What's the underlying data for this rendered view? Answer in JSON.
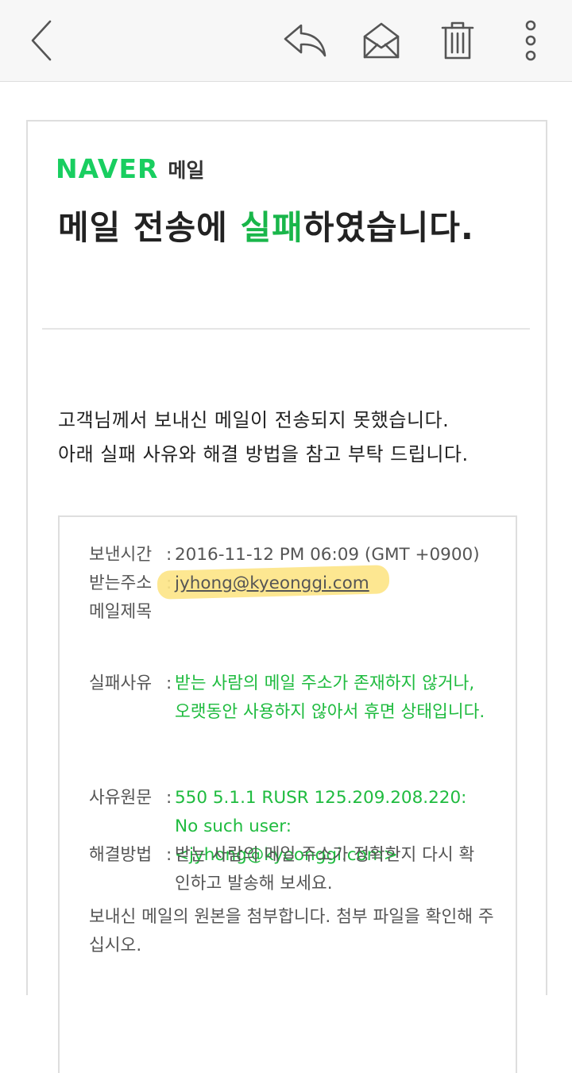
{
  "toolbar": {
    "icons": [
      "back-chevron-icon",
      "reply-icon",
      "mark-unread-icon",
      "trash-icon",
      "more-vertical-icon"
    ]
  },
  "brand": {
    "logo": "NAVER",
    "service": "메일"
  },
  "heading": {
    "before": "메일 전송에 ",
    "accent": "실패",
    "after": "하였습니다."
  },
  "intro": {
    "line1": "고객님께서 보내신 메일이 전송되지 못했습니다.",
    "line2": "아래 실패 사유와 해결 방법을 참고 부탁 드립니다."
  },
  "details": {
    "sent_time_label": "보낸시간",
    "sent_time_value": "2016-11-12 PM 06:09 (GMT +0900)",
    "recipient_label": "받는주소",
    "recipient_value": "jyhong@kyeonggi.com",
    "subject_label": "메일제목",
    "subject_value": "",
    "reason_label": "실패사유",
    "reason_value": "받는 사람의 메일 주소가 존재하지 않거나,\n오랫동안 사용하지 않아서 휴면 상태입니다.",
    "raw_label": "사유원문",
    "raw_value": "550 5.1.1 RUSR 125.209.208.220: No such user: <jyhong@kyeonggi.com>",
    "solution_label": "해결방법",
    "solution_value": "받는 사람의 메일 주소가 정확한지 다시 확인하고 발송해 보세요.",
    "colon": ":",
    "attachment_note": "보내신 메일의 원본을 첨부합니다. 첨부 파일을 확인해 주십시오."
  },
  "colors": {
    "brand_green": "#19ce60",
    "accent_green": "#19b64a",
    "highlight": "#fde485"
  }
}
